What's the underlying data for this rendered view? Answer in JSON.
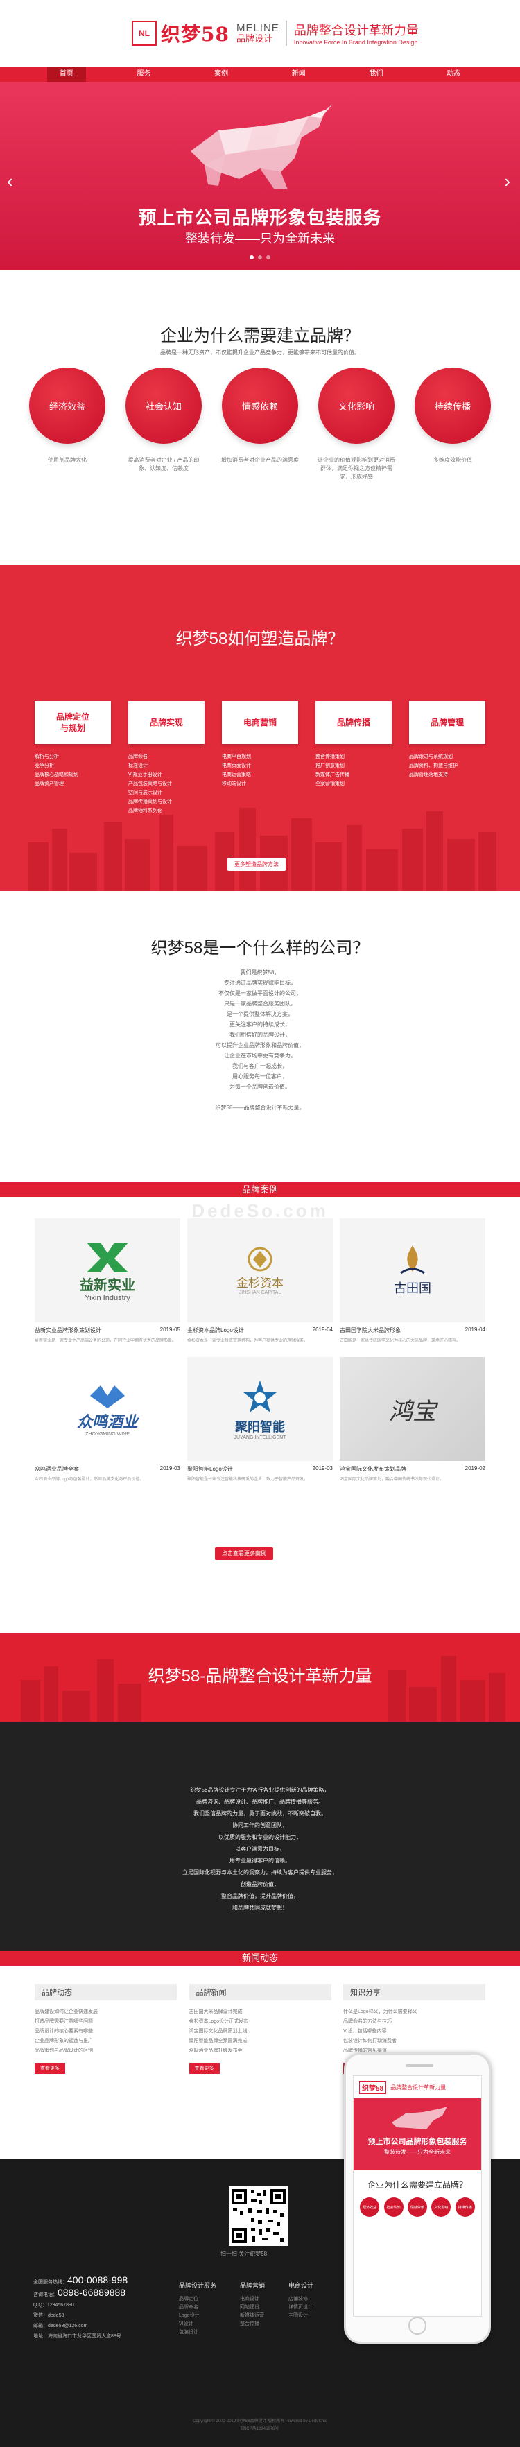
{
  "brand": {
    "mark": "NL",
    "cn": "织梦58",
    "en_top": "MELINE",
    "en_bottom": "品牌设计",
    "slogan": "品牌整合设计革新力量",
    "slogan_en": "Innovative Force In Brand Integration Design"
  },
  "nav": [
    "首页",
    "服务",
    "案例",
    "新闻",
    "我们",
    "动态"
  ],
  "banner": {
    "title": "预上市公司品牌形象包装服务",
    "subtitle": "整装待发——只为全新未来"
  },
  "why": {
    "title": "企业为什么需要建立品牌？",
    "subtitle": "品牌是一种无形资产，不仅能提升企业产品竞争力，更能够带来不可估量的价值。",
    "items": [
      {
        "label": "经济效益",
        "desc": "使用剂品牌大化"
      },
      {
        "label": "社会认知",
        "desc": "提高消费者对企业 / 产品的印象、认知度、信赖度"
      },
      {
        "label": "情感依赖",
        "desc": "增加消费者对企业产品的满意度"
      },
      {
        "label": "文化影响",
        "desc": "让企业的价值观影响到更对消费群体，满足你视之方位精神需求，形成好感"
      },
      {
        "label": "持续传播",
        "desc": "多维度效能价值"
      }
    ]
  },
  "how": {
    "title": "织梦58如何塑造品牌？",
    "button": "更多塑造品牌方法",
    "stages": [
      {
        "label": "品牌定位\n与规划",
        "items": [
          "解析与分析",
          "竞争分析",
          "品牌核心战略和规划",
          "品牌资产管理"
        ]
      },
      {
        "label": "品牌实现",
        "items": [
          "品牌命名",
          "标准设计",
          "VI规范手册设计",
          "产品包装策略与设计",
          "空间与展示设计",
          "品牌传播策划与设计",
          "品牌物料系列化"
        ]
      },
      {
        "label": "电商营销",
        "items": [
          "电商平台规划",
          "电商页面设计",
          "电商运营策略",
          "移动端设计"
        ]
      },
      {
        "label": "品牌传播",
        "items": [
          "整合传播策划",
          "推广创意策划",
          "新媒体广告传播",
          "全案营销策划"
        ]
      },
      {
        "label": "品牌管理",
        "items": [
          "品牌跟进与系统规划",
          "品牌资料、构造与维护",
          "品牌管理落地支持"
        ]
      }
    ]
  },
  "what": {
    "title": "织梦58是一个什么样的公司？",
    "lines": [
      "我们是织梦58，",
      "专注通过品牌实现赋能目标，",
      "不仅仅是一家做平面设计的公司，",
      "只是一家品牌整合服务团队，",
      "是一个提供整体解决方案，",
      "更关注客户的持续成长，",
      "我们相信好的品牌设计，",
      "可以提升企业品牌形象和品牌价值，",
      "让企业在市场中更有竞争力。",
      "我们与客户一起成长，",
      "用心服务每一位客户，",
      "为每一个品牌创造价值。",
      "",
      "织梦58——品牌整合设计革新力量。"
    ]
  },
  "cases": {
    "title": "品牌案例",
    "watermark": "DedeSo.com",
    "button": "点击查看更多案例",
    "items": [
      {
        "name": "益新实业品牌形象策划设计",
        "logo_cn": "益新实业",
        "logo_en": "Yixin Industry",
        "date": "2019-05",
        "desc": "益新实业是一家专业生产高端设备的公司，在同行业中拥有优秀的品牌形象。"
      },
      {
        "name": "金杉资本品牌Logo设计",
        "logo_cn": "金杉资本",
        "logo_en": "JINSHAN CAPITAL",
        "date": "2019-04",
        "desc": "金杉资本是一家专业投资管理机构，为客户提供专业的理财服务。"
      },
      {
        "name": "古田国学院大米品牌形象",
        "logo_cn": "古田国",
        "logo_en": "",
        "date": "2019-04",
        "desc": "古田国是一家以传统国学文化为核心的大米品牌，秉承匠心精神。"
      },
      {
        "name": "众鸣酒业品牌全案",
        "logo_cn": "众鸣酒业",
        "logo_en": "ZHONGMING WINE",
        "date": "2019-03",
        "desc": "众鸣酒业品牌Logo与包装设计，彰显品牌文化与产品价值。"
      },
      {
        "name": "聚阳智能Logo设计",
        "logo_cn": "聚阳智能",
        "logo_en": "JUYANG INTELLIGENT",
        "date": "2019-03",
        "desc": "聚阳智能是一家专注智能科技研发的企业，致力于智能产品开发。"
      },
      {
        "name": "鸿宝国际文化发布策划品牌",
        "logo_cn": "鸿宝",
        "logo_en": "",
        "date": "2019-02",
        "desc": "鸿宝国际文化品牌策划，融合中国传统书法与现代设计。"
      }
    ]
  },
  "integration": {
    "title": "织梦58-品牌整合设计革新力量"
  },
  "intro": {
    "lines": [
      "织梦58品牌设计专注于为各行各业提供创新的品牌策略，",
      "品牌咨询、品牌设计、品牌推广、品牌传播等服务。",
      "我们坚信品牌的力量，勇于面对挑战，不断突破自我。",
      "协同工作的创意团队，",
      "以优质的服务和专业的设计能力，",
      "以客户满意为目标，",
      "用专业赢得客户的信赖。",
      "立足国际化视野与本土化的洞察力，持续为客户提供专业服务，",
      "创造品牌价值，",
      "整合品牌价值，提升品牌价值，",
      "和品牌共同成就梦想！"
    ]
  },
  "news": {
    "title": "新闻动态",
    "more": "查看更多",
    "columns": [
      {
        "head": "品牌动态",
        "items": [
          "品牌建设如何让企业快速发展",
          "打造品牌需要注意哪些问题",
          "品牌设计的核心要素有哪些",
          "企业品牌形象的塑造与推广",
          "品牌策划与品牌设计的区别"
        ]
      },
      {
        "head": "品牌新闻",
        "items": [
          "古田国大米品牌设计完成",
          "金杉资本Logo设计正式发布",
          "鸿宝国际文化品牌策划上线",
          "聚阳智能品牌全案圆满完成",
          "众鸣酒业品牌升级发布会"
        ]
      },
      {
        "head": "知识分享",
        "items": [
          "什么是Logo释义，为什么需要释义",
          "品牌命名的方法与技巧",
          "VI设计包括哪些内容",
          "包装设计如何打动消费者",
          "品牌传播的常见渠道"
        ]
      }
    ]
  },
  "footer": {
    "qr_caption": "扫一扫 关注织梦58",
    "hotline_label": "全国服务热线：",
    "hotline": "400-0088-998",
    "tel_label": "咨询电话：",
    "tel": "0898-66889888",
    "contacts": [
      "Q Q：1234567890",
      "微信：dede58",
      "邮箱：dede58@126.com",
      "地址：海南省海口市龙华区国贸大道88号"
    ],
    "cols": [
      {
        "title": "品牌设计服务",
        "items": [
          "品牌定位",
          "品牌命名",
          "Logo设计",
          "VI设计",
          "包装设计"
        ]
      },
      {
        "title": "品牌营销",
        "items": [
          "电商设计",
          "网站建设",
          "新媒体运营",
          "整合传播"
        ]
      },
      {
        "title": "电商设计",
        "items": [
          "店铺装修",
          "详情页设计",
          "主图设计"
        ]
      }
    ],
    "copyright": "Copyright © 2002-2019 织梦58品牌设计 版权所有 Powered by DedeCms",
    "icp": "琼ICP备12345678号"
  },
  "phone": {
    "logo": "织梦58",
    "slogan": "品牌整合设计革新力量",
    "banner_title": "预上市公司品牌形象包装服务",
    "banner_sub": "整装待发——只为全新未来",
    "why": "企业为什么需要建立品牌？",
    "circles": [
      "经济效益",
      "社会认知",
      "情感依赖",
      "文化影响",
      "持续传播"
    ]
  },
  "colors": {
    "primary": "#e01f35",
    "dark": "#222222"
  }
}
